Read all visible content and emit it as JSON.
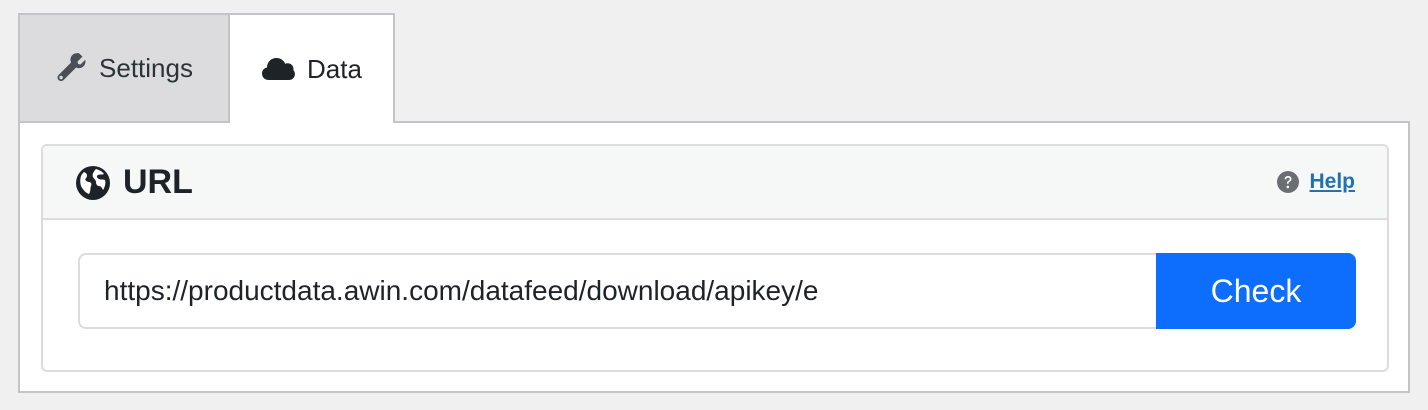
{
  "tabs": [
    {
      "label": "Settings",
      "icon": "wrench-icon",
      "active": false
    },
    {
      "label": "Data",
      "icon": "cloud-icon",
      "active": true
    }
  ],
  "card": {
    "title": "URL",
    "title_icon": "globe-icon",
    "help_label": "Help",
    "help_icon": "question-circle-icon"
  },
  "url_field": {
    "value": "https://productdata.awin.com/datafeed/download/apikey/e"
  },
  "check_button": {
    "label": "Check"
  },
  "colors": {
    "accent": "#0d6efd",
    "link": "#2271b1",
    "inactive_tab": "#dcdcde"
  }
}
